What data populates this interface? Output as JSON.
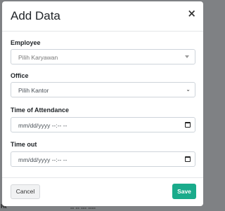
{
  "backdrop": {
    "bottom_left_text": "Ht",
    "bottom_center_text": "-- -- --- ----"
  },
  "modal": {
    "title": "Add Data",
    "close_label": "×",
    "fields": {
      "employee": {
        "label": "Employee",
        "placeholder": "Pilih Karyawan"
      },
      "office": {
        "label": "Office",
        "selected": "Pilih Kantor"
      },
      "time_in": {
        "label": "Time of Attendance",
        "placeholder": "mm/dd/yyyy --:-- --"
      },
      "time_out": {
        "label": "Time out",
        "placeholder": "mm/dd/yyyy --:-- --"
      }
    },
    "footer": {
      "cancel_label": "Cancel",
      "save_label": "Save"
    },
    "colors": {
      "save_button": "#1aab8b",
      "backdrop": "#7f8184"
    }
  }
}
